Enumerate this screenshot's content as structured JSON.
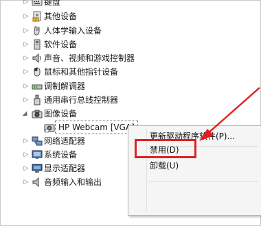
{
  "device_tree": {
    "categories": [
      {
        "label": "键盘",
        "icon": "keyboard-icon"
      },
      {
        "label": "其他设备",
        "icon": "unknown-device-icon"
      },
      {
        "label": "人体学输入设备",
        "icon": "hid-icon"
      },
      {
        "label": "软件设备",
        "icon": "software-device-icon"
      },
      {
        "label": "声音、视频和游戏控制器",
        "icon": "speaker-icon"
      },
      {
        "label": "鼠标和其他指针设备",
        "icon": "mouse-icon"
      },
      {
        "label": "调制解调器",
        "icon": "modem-icon"
      },
      {
        "label": "通用串行总线控制器",
        "icon": "usb-icon"
      },
      {
        "label": "图像设备",
        "icon": "camera-icon"
      },
      {
        "label": "网络适配器",
        "icon": "network-icon"
      },
      {
        "label": "系统设备",
        "icon": "system-device-icon"
      },
      {
        "label": "显示适配器",
        "icon": "display-adapter-icon"
      },
      {
        "label": "音频输入和输出",
        "icon": "audio-io-icon"
      }
    ],
    "selected_device": {
      "label": "HP Webcam [VGA]",
      "icon": "webcam-icon"
    }
  },
  "context_menu": {
    "items": [
      {
        "label": "更新驱动程序软件(P)..."
      },
      {
        "label": "禁用(D)"
      },
      {
        "label": "卸载(U)"
      }
    ]
  },
  "annotation": {
    "highlight_color": "#e02020",
    "target": "禁用(D)"
  }
}
